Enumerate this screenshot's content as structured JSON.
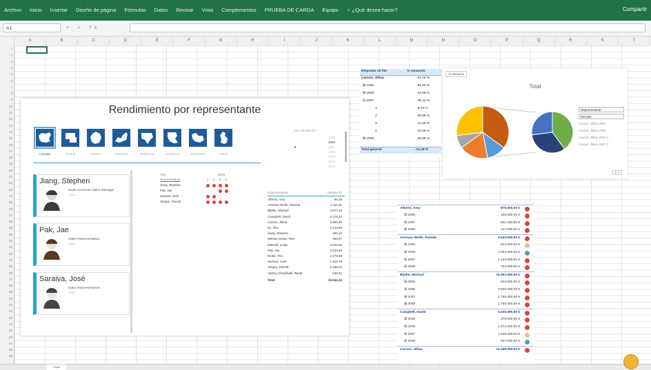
{
  "ribbon": {
    "tabs": [
      "Archivo",
      "Inicio",
      "Insertar",
      "Diseño de página",
      "Fórmulas",
      "Datos",
      "Revisar",
      "Vista",
      "Complementos",
      "PRUEBA DE CARGA",
      "Equipo",
      "♀ ¿Qué desea hacer?"
    ],
    "share": "Compartir",
    "color": "#217346"
  },
  "formula_bar": {
    "name_box": "A1",
    "ops": "× ✓ fx"
  },
  "columns": [
    "A",
    "B",
    "C",
    "D",
    "E",
    "F",
    "G",
    "H",
    "I",
    "J",
    "K",
    "L",
    "M",
    "N",
    "O",
    "P",
    "Q",
    "R",
    "S",
    "T"
  ],
  "rows": [
    "1",
    "2",
    "3",
    "4",
    "5",
    "6",
    "7",
    "8",
    "9",
    "10",
    "11",
    "12",
    "13",
    "14",
    "15",
    "16",
    "17",
    "18",
    "19",
    "20",
    "21",
    "22",
    "23",
    "24",
    "25",
    "26",
    "27",
    "28",
    "29",
    "30",
    "31",
    "32",
    "33",
    "34",
    "35",
    "36",
    "37",
    "38",
    "39",
    "40",
    "41",
    "42",
    "43",
    "44",
    "45",
    "46",
    "47",
    "48",
    "49"
  ],
  "dashboard": {
    "title": "Rendimiento por representante",
    "states": [
      {
        "label": "Canadá",
        "icon": "canada-map-icon"
      },
      {
        "label": "Central",
        "icon": "central-map-icon"
      },
      {
        "label": "France",
        "icon": "france-map-icon"
      },
      {
        "label": "Northeast",
        "icon": "northeast-map-icon"
      },
      {
        "label": "Northwest",
        "icon": "northwest-map-icon"
      },
      {
        "label": "Southeast",
        "icon": "southeast-map-icon"
      },
      {
        "label": "Southwest",
        "icon": "southwest-map-icon"
      },
      {
        "label": "United",
        "icon": "united-kingdom-map-icon"
      }
    ],
    "years_title": "Año del período",
    "years": [
      "2005",
      "2006",
      "2007",
      "2008",
      "2009",
      "2010",
      "2011"
    ],
    "selected_year": "2006",
    "cards": [
      {
        "name": "Jiang, Stephen",
        "role": "North American Sales Manager",
        "sub": "Título"
      },
      {
        "name": "Pak, Jae",
        "role": "Sales Representative",
        "sub": "Título"
      },
      {
        "name": "Saraiva, José",
        "role": "Sales Representative",
        "sub": "Título"
      }
    ],
    "matrix": {
      "year_label": "Año",
      "year_value": "2006",
      "rep_label": "Representante",
      "quarters": [
        "1",
        "2",
        "3",
        "4"
      ],
      "rows": [
        {
          "name": "Jiang, Stephen",
          "dots": [
            1,
            1,
            1,
            1
          ]
        },
        {
          "name": "Pak, Jae",
          "dots": [
            0,
            0,
            1,
            1
          ]
        },
        {
          "name": "Saraiva, José",
          "dots": [
            1,
            1,
            0,
            0
          ]
        },
        {
          "name": "Vargas, Garrett",
          "dots": [
            1,
            1,
            1,
            1
          ]
        }
      ]
    },
    "table": {
      "h1": "Representante",
      "h2": "Destino fin",
      "rows": [
        {
          "n": "Alberts, Amy",
          "v": "66,38"
        },
        {
          "n": "Ansman-Wolfe, Pamela",
          "v": "3.111,51"
        },
        {
          "n": "Blythe, Michael",
          "v": "3.877,33"
        },
        {
          "n": "Campbell, David",
          "v": "2.176,23"
        },
        {
          "n": "Carson, Jillian",
          "v": "3.865,36"
        },
        {
          "n": "Ito, Shu",
          "v": "2.123,98"
        },
        {
          "n": "Jiang, Stephen",
          "v": "356,22"
        },
        {
          "n": "Mensa-Annan, Tete",
          "v": "256,07"
        },
        {
          "n": "Mitchell, Linda",
          "v": "3.224,95"
        },
        {
          "n": "Pak, Jae",
          "v": "2.622,83"
        },
        {
          "n": "Reiter, Tsvi",
          "v": "2.478,59"
        },
        {
          "n": "Saraiva, José",
          "v": "1.813,79"
        },
        {
          "n": "Vargas, Garrett",
          "v": "1.188,21"
        },
        {
          "n": "Varkey Chudukatil, Ranjit",
          "v": "848,51"
        }
      ],
      "total_label": "Total",
      "total_value": "26.544,42"
    }
  },
  "pivot1": {
    "h1": "Etiquetas de fila",
    "h2": "% variación",
    "rows": [
      {
        "k": "Carson, Jillian",
        "v": "-21,18 %",
        "b": true
      },
      {
        "k": "⊞ 2005",
        "v": "-51,20 %",
        "b": false
      },
      {
        "k": "⊞ 2006",
        "v": "-24,89 %",
        "b": false
      },
      {
        "k": "⊟ 2007",
        "v": "-35,44 %",
        "b": false
      },
      {
        "k": "1",
        "v": "-9,70 %",
        "b": false
      },
      {
        "k": "2",
        "v": "-28,99 %",
        "b": false
      },
      {
        "k": "3",
        "v": "-14,45 %",
        "b": false
      },
      {
        "k": "4",
        "v": "-22,58 %",
        "b": false
      },
      {
        "k": "⊞ 2008",
        "v": "-29,96 %",
        "b": false
      }
    ],
    "total_k": "Total general",
    "total_v": "-21,18 %"
  },
  "chart": {
    "button": "% variación",
    "title": "Total",
    "legend_header": "Representante",
    "legend_filter": "Período",
    "legend_items": [
      "Carson, Jillian 2005",
      "Carson, Jillian 2006",
      "Carson, Jillian 2007 1",
      "Carson, Jillian 2007 2"
    ],
    "zoom": "⊞ ⊟",
    "pie1": [
      {
        "value": 35,
        "color": "#c55a11"
      },
      {
        "value": 12,
        "color": "#5b9bd5"
      },
      {
        "value": 18,
        "color": "#ed7d31"
      },
      {
        "value": 8,
        "color": "#a5a5a5"
      },
      {
        "value": 27,
        "color": "#ffc000"
      }
    ],
    "pie2": [
      {
        "value": 40,
        "color": "#70ad47"
      },
      {
        "value": 33,
        "color": "#264478"
      },
      {
        "value": 27,
        "color": "#4472c4"
      }
    ]
  },
  "pivot2": {
    "rows": [
      {
        "k": "Alberts, Amy",
        "v": "876.000,00 €",
        "b": true,
        "c": "#d9453f"
      },
      {
        "k": "⊞ 2006",
        "v": "108.000,00 €",
        "b": false,
        "c": "#d9453f"
      },
      {
        "k": "⊞ 2007",
        "v": "601.000,00 €",
        "b": false,
        "c": "#d9453f"
      },
      {
        "k": "⊞ 2008",
        "v": "117.000,00 €",
        "b": false,
        "c": "#d9453f"
      },
      {
        "k": "Ansman-Wolfe, Pamela",
        "v": "3.533.000,00 €",
        "b": true,
        "c": "#d9453f"
      },
      {
        "k": "⊞ 2005",
        "v": "634.000,00 €",
        "b": false,
        "c": "#f0c080"
      },
      {
        "k": "⊞ 2006",
        "v": "1.093.000,00 €",
        "b": false,
        "c": "#4aa3a0"
      },
      {
        "k": "⊞ 2007",
        "v": "1.103.000,00 €",
        "b": false,
        "c": "#d9453f"
      },
      {
        "k": "⊞ 2008",
        "v": "703.000,00 €",
        "b": false,
        "c": "#d9453f"
      },
      {
        "k": "Blythe, Michael",
        "v": "15.262.000,00 €",
        "b": true,
        "c": "#d9453f"
      },
      {
        "k": "⊞ 2005",
        "v": "923.000,00 €",
        "b": false,
        "c": "#d9453f"
      },
      {
        "k": "⊞ 2006",
        "v": "3.805.000,00 €",
        "b": false,
        "c": "#d9453f"
      },
      {
        "k": "⊞ 2007",
        "v": "4.758.000,00 €",
        "b": false,
        "c": "#d9453f"
      },
      {
        "k": "⊞ 2008",
        "v": "1.758.000,00 €",
        "b": false,
        "c": "#d9453f"
      },
      {
        "k": "Campbell, David",
        "v": "4.025.000,00 €",
        "b": true,
        "c": "#d9453f"
      },
      {
        "k": "⊞ 2005",
        "v": "379.000,00 €",
        "b": false,
        "c": "#d9453f"
      },
      {
        "k": "⊞ 2006",
        "v": "1.372.000,00 €",
        "b": false,
        "c": "#d9453f"
      },
      {
        "k": "⊞ 2007",
        "v": "1.638.000,00 €",
        "b": false,
        "c": "#f0c080"
      },
      {
        "k": "⊞ 2008",
        "v": "637.000,00 €",
        "b": false,
        "c": "#4aa3a0"
      },
      {
        "k": "Carson, Jillian",
        "v": "12.198.000,00 €",
        "b": true,
        "c": "#d9453f"
      }
    ]
  },
  "sheet_tab": "Hoja1"
}
